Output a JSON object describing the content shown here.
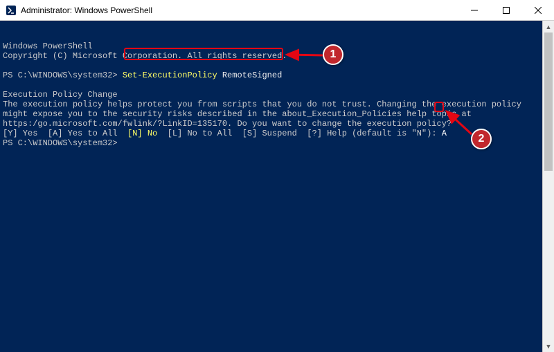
{
  "window": {
    "title": "Administrator: Windows PowerShell"
  },
  "console": {
    "banner_line1": "Windows PowerShell",
    "banner_line2": "Copyright (C) Microsoft Corporation. All rights reserved.",
    "prompt1_prefix": "PS C:\\WINDOWS\\system32> ",
    "command": "Set-ExecutionPolicy",
    "command_arg": "RemoteSigned",
    "policy_heading": "Execution Policy Change",
    "policy_body": "The execution policy helps protect you from scripts that you do not trust. Changing the execution policy might expose you to the security risks described in the about_Execution_Policies help topic at https:/go.microsoft.com/fwlink/?LinkID=135170. Do you want to change the execution policy?",
    "choice_yes": "[Y] Yes  ",
    "choice_yes_all": "[A] Yes to All  ",
    "choice_no_label": "[N] No",
    "choice_rest": "  [L] No to All  [S] Suspend  [?] Help (default is \"N\"):",
    "user_input": "A",
    "prompt2": "PS C:\\WINDOWS\\system32> "
  },
  "annotations": {
    "badge1": "1",
    "badge2": "2"
  }
}
